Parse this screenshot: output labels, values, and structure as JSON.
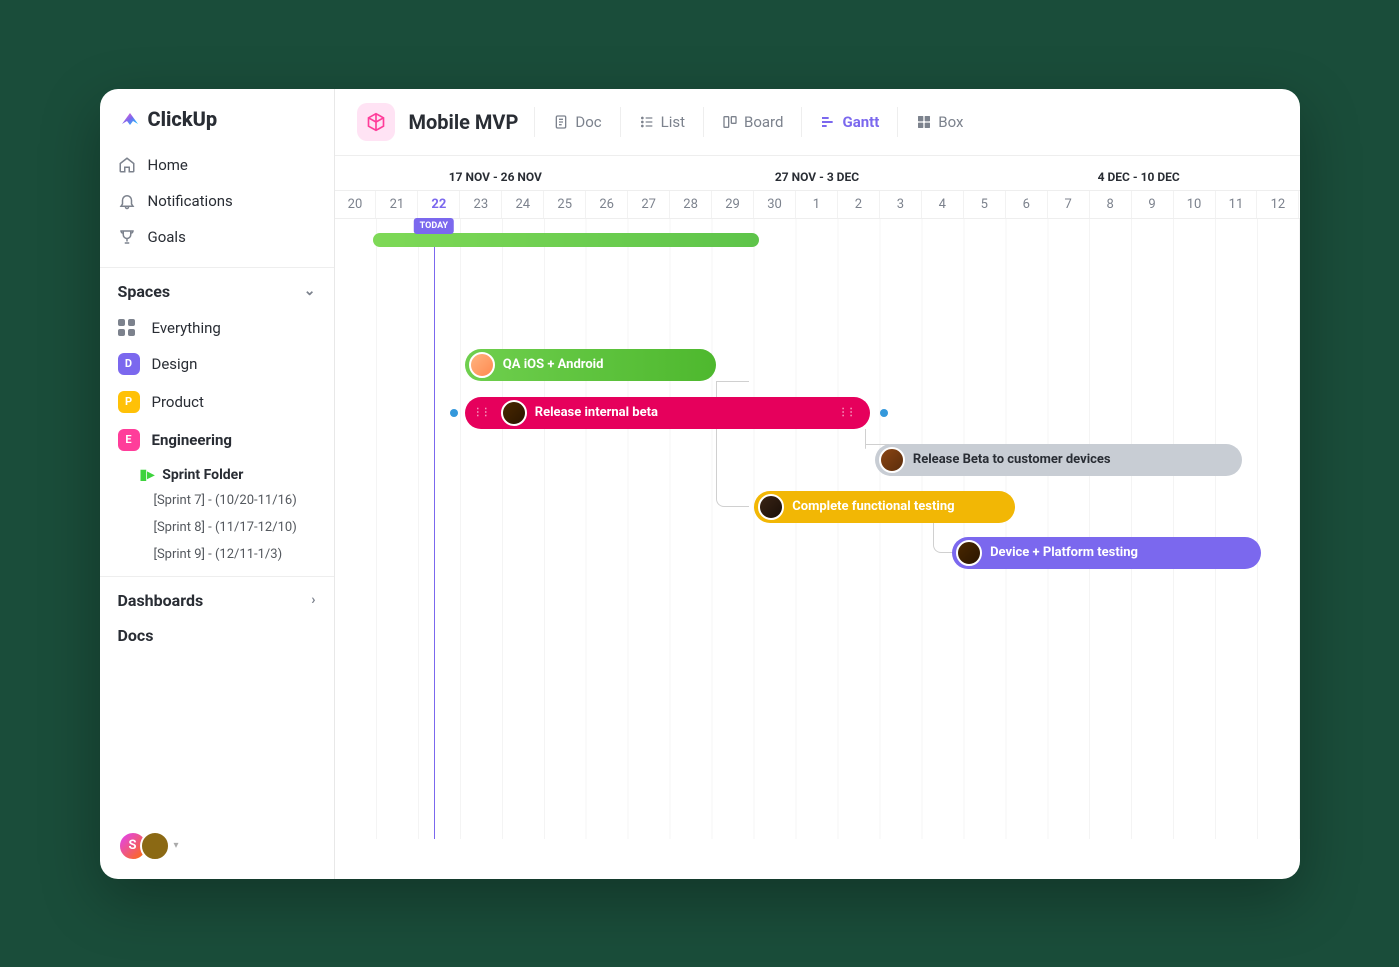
{
  "app": {
    "name": "ClickUp"
  },
  "nav": {
    "home": "Home",
    "notifications": "Notifications",
    "goals": "Goals"
  },
  "spaces": {
    "header": "Spaces",
    "everything": "Everything",
    "items": [
      {
        "label": "Design",
        "badge": "D",
        "color": "#7b68ee"
      },
      {
        "label": "Product",
        "badge": "P",
        "color": "#ffc107"
      },
      {
        "label": "Engineering",
        "badge": "E",
        "color": "#ff3d9a"
      }
    ],
    "sprint_folder": "Sprint Folder",
    "sprints": [
      "[Sprint 7] - (10/20-11/16)",
      "[Sprint 8] - (11/17-12/10)",
      "[Sprint 9] - (12/11-1/3)"
    ]
  },
  "sections": {
    "dashboards": "Dashboards",
    "docs": "Docs"
  },
  "user_badge": "S",
  "project": {
    "title": "Mobile MVP"
  },
  "views": {
    "doc": "Doc",
    "list": "List",
    "board": "Board",
    "gantt": "Gantt",
    "box": "Box"
  },
  "timeline": {
    "weeks": [
      "17  NOV - 26 NOV",
      "27  NOV - 3 DEC",
      "4  DEC - 10 DEC"
    ],
    "days": [
      "20",
      "21",
      "22",
      "23",
      "24",
      "25",
      "26",
      "27",
      "28",
      "29",
      "30",
      "1",
      "2",
      "3",
      "4",
      "5",
      "6",
      "7",
      "8",
      "9",
      "10",
      "11",
      "12"
    ],
    "today_index": 2,
    "today_label": "TODAY"
  },
  "tasks": {
    "top_green": "",
    "qa": "QA iOS + Android",
    "release_internal": "Release internal beta",
    "release_beta": "Release Beta to customer devices",
    "functional": "Complete functional testing",
    "device": "Device + Platform testing"
  }
}
